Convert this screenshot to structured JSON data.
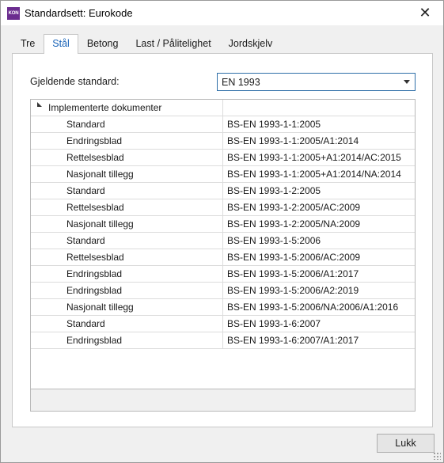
{
  "window": {
    "icon_text": "KON",
    "title": "Standardsett: Eurokode",
    "close_glyph": "✕"
  },
  "tabs": [
    {
      "label": "Tre",
      "active": false
    },
    {
      "label": "Stål",
      "active": true
    },
    {
      "label": "Betong",
      "active": false
    },
    {
      "label": "Last / Pålitelighet",
      "active": false
    },
    {
      "label": "Jordskjelv",
      "active": false
    }
  ],
  "standard": {
    "label": "Gjeldende standard:",
    "selected": "EN 1993"
  },
  "grid": {
    "group_label": "Implementerte dokumenter",
    "rows": [
      {
        "type": "Standard",
        "doc": "BS-EN 1993-1-1:2005"
      },
      {
        "type": "Endringsblad",
        "doc": "BS-EN 1993-1-1:2005/A1:2014"
      },
      {
        "type": "Rettelsesblad",
        "doc": "BS-EN 1993-1-1:2005+A1:2014/AC:2015"
      },
      {
        "type": "Nasjonalt tillegg",
        "doc": "BS-EN 1993-1-1:2005+A1:2014/NA:2014"
      },
      {
        "type": "Standard",
        "doc": "BS-EN 1993-1-2:2005"
      },
      {
        "type": "Rettelsesblad",
        "doc": "BS-EN 1993-1-2:2005/AC:2009"
      },
      {
        "type": "Nasjonalt tillegg",
        "doc": "BS-EN 1993-1-2:2005/NA:2009"
      },
      {
        "type": "Standard",
        "doc": "BS-EN 1993-1-5:2006"
      },
      {
        "type": "Rettelsesblad",
        "doc": "BS-EN 1993-1-5:2006/AC:2009"
      },
      {
        "type": "Endringsblad",
        "doc": "BS-EN 1993-1-5:2006/A1:2017"
      },
      {
        "type": "Endringsblad",
        "doc": "BS-EN 1993-1-5:2006/A2:2019"
      },
      {
        "type": "Nasjonalt tillegg",
        "doc": "BS-EN 1993-1-5:2006/NA:2006/A1:2016"
      },
      {
        "type": "Standard",
        "doc": "BS-EN 1993-1-6:2007"
      },
      {
        "type": "Endringsblad",
        "doc": "BS-EN 1993-1-6:2007/A1:2017"
      }
    ]
  },
  "buttons": {
    "close_label": "Lukk"
  },
  "colors": {
    "app_icon": "#6b2d8f",
    "active_tab_text": "#1a64b8",
    "select_border": "#2f6fa8"
  }
}
